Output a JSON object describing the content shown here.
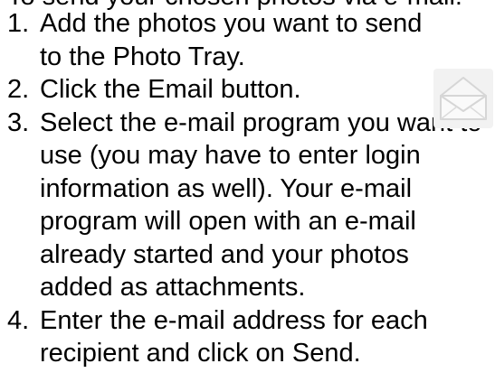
{
  "heading_partial": "To send your chosen photos via e-mail:",
  "steps": [
    {
      "number": "1.",
      "text": "Add the photos you want to send to the Photo Tray."
    },
    {
      "number": "2.",
      "text": "Click the Email button."
    },
    {
      "number": "3.",
      "text": "Select the e-mail program you want to use (you may have to enter login information as well). Your e-mail program will open with an e-mail already started and your photos added as attachments."
    },
    {
      "number": "4.",
      "text": "Enter the e-mail address for each recipient and click on Send."
    }
  ],
  "email_icon": {
    "icon": "envelope-icon",
    "color": "#d9d9d9"
  }
}
